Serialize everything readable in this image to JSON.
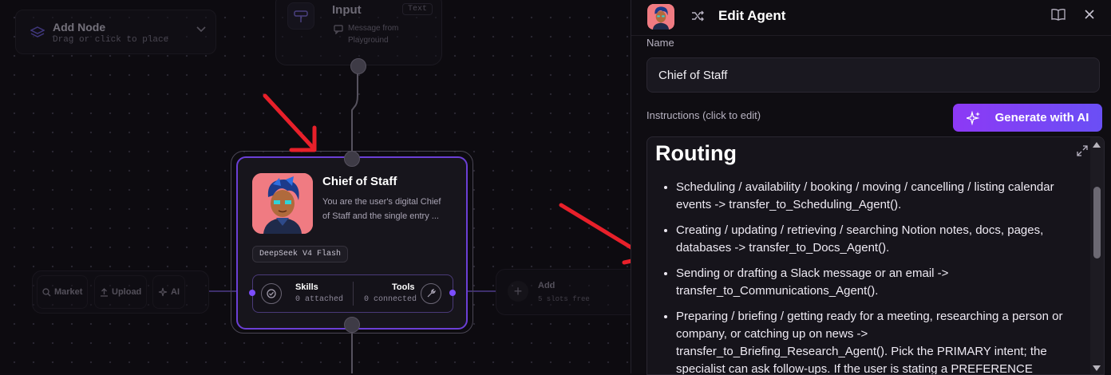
{
  "canvas": {
    "add_node": {
      "title": "Add Node",
      "subtitle": "Drag or click to place"
    },
    "input_node": {
      "title": "Input",
      "badge": "Text",
      "desc_line1": "Message from",
      "desc_line2": "Playground"
    },
    "agent_node": {
      "name": "Chief of Staff",
      "desc_line1": "You are the user's digital Chief",
      "desc_line2": "of Staff and the single entry ...",
      "model": "DeepSeek V4 Flash",
      "skills": {
        "label": "Skills",
        "count": "0 attached"
      },
      "tools": {
        "label": "Tools",
        "count": "0 connected"
      }
    },
    "toolbar": {
      "market": "Market",
      "upload": "Upload",
      "ai": "AI"
    },
    "add_slot": {
      "title": "Add",
      "subtitle": "5 slots free"
    }
  },
  "panel": {
    "title": "Edit Agent",
    "name_label": "Name",
    "name_value": "Chief of Staff",
    "instructions_label": "Instructions (click to edit)",
    "generate_button": "Generate with AI",
    "instructions": {
      "heading": "Routing",
      "items": [
        "Scheduling / availability / booking / moving / cancelling / listing calendar events -> transfer_to_Scheduling_Agent().",
        "Creating / updating / retrieving / searching Notion notes, docs, pages, databases -> transfer_to_Docs_Agent().",
        "Sending or drafting a Slack message or an email -> transfer_to_Communications_Agent().",
        "Preparing / briefing / getting ready for a meeting, researching a person or company, or catching up on news -> transfer_to_Briefing_Research_Agent(). Pick the PRIMARY intent; the specialist can ask follow-ups. If the user is stating a PREFERENCE"
      ]
    }
  },
  "colors": {
    "accent": "#7c4dff",
    "annotation_arrow": "#e8202a",
    "avatar_bg": "#f07b82"
  }
}
